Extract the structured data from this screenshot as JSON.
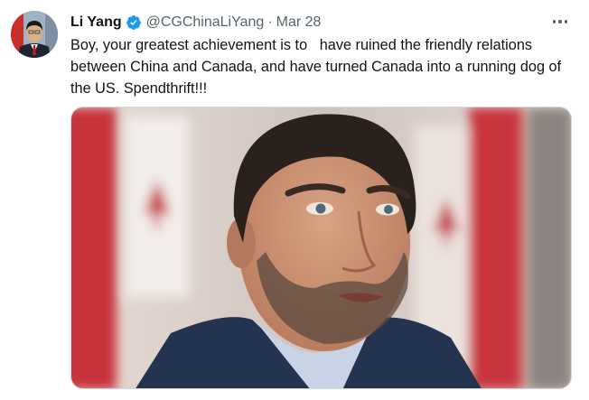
{
  "tweet": {
    "author": {
      "name": "Li Yang",
      "handle": "@CGChinaLiYang",
      "verified": true
    },
    "separator": "·",
    "date": "Mar 28",
    "text": "Boy, your greatest achievement is to   have ruined the friendly relations between China and Canada, and have turned Canada into a running dog of the US. Spendthrift!!!",
    "media": {
      "type": "photo",
      "alt": ""
    }
  },
  "colors": {
    "text_primary": "#0f1419",
    "text_secondary": "#536471",
    "verified_blue": "#1d9bf0"
  },
  "icons": {
    "verified": "verified-badge-icon",
    "more": "more-options-icon"
  }
}
